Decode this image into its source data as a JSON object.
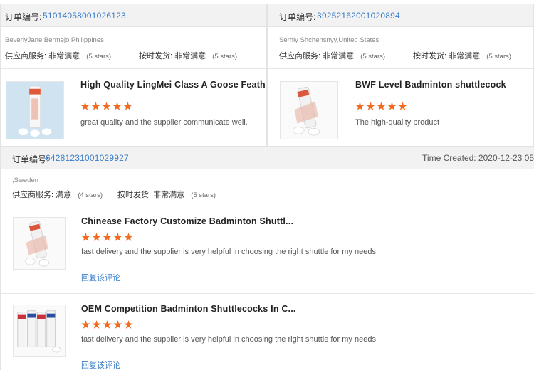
{
  "order_label": "订单编号:",
  "supplier_service_label": "供应商服务:",
  "on_time_label": "按时发货:",
  "reply_label": "回复该评论",
  "colors": {
    "link": "#3b7ec8",
    "star": "#f26a1f",
    "header_bg": "#f2f2f2"
  },
  "orders": [
    {
      "order_number": "5101405800102612​3",
      "buyer": "BeverlyJane Bermejo,Philippines",
      "supplier_rating": "非常满意",
      "supplier_stars": "(5 stars)",
      "delivery_rating": "非常满意",
      "delivery_stars": "(5 stars)",
      "items": [
        {
          "title": "High Quality LingMei Class A Goose Feather",
          "rating": 5,
          "comment": "great quality and the supplier communicate well.",
          "thumb_icon": "shuttlecock-tube-image"
        }
      ]
    },
    {
      "order_number": "39252162001020894",
      "buyer": "Serhiy Shchensnyy,United States",
      "supplier_rating": "非常满意",
      "supplier_stars": "(5 stars)",
      "delivery_rating": "非常满意",
      "delivery_stars": "(5 stars)",
      "items": [
        {
          "title": "BWF Level Badminton shuttlecock",
          "rating": 5,
          "comment": "The high-quality product",
          "thumb_icon": "shuttlecock-tube-image"
        }
      ]
    },
    {
      "order_number": "64281231001029927",
      "time_created": "Time Created: 2020-12-23 05",
      "buyer": ",Sweden",
      "supplier_rating": "满意",
      "supplier_stars": "(4 stars)",
      "delivery_rating": "非常满意",
      "delivery_stars": "(5 stars)",
      "items": [
        {
          "title": "Chinease Factory Customize Badminton Shuttl...",
          "rating": 5,
          "comment": "fast delivery and the supplier is very helpful in choosing the right shuttle for my needs",
          "thumb_icon": "shuttlecock-tube-image"
        },
        {
          "title": "OEM Competition Badminton Shuttlecocks In C...",
          "rating": 5,
          "comment": "fast delivery and the supplier is very helpful in choosing the right shuttle for my needs",
          "thumb_icon": "shuttlecock-tubes-image"
        }
      ]
    }
  ]
}
